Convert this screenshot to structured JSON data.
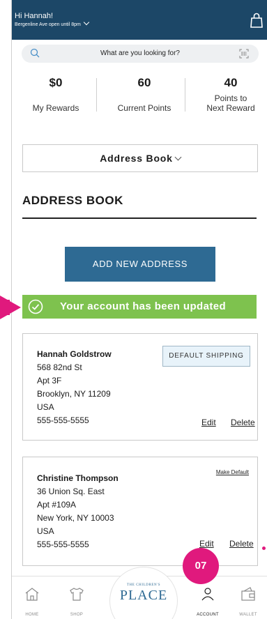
{
  "header": {
    "greeting": "Hi Hannah!",
    "store_status": "Bergenline Ave open until 8pm"
  },
  "search": {
    "placeholder": "What are you looking for?"
  },
  "stats": [
    {
      "value": "$0",
      "label": "My Rewards"
    },
    {
      "value": "60",
      "label": "Current Points"
    },
    {
      "value": "40",
      "label_line1": "Points to",
      "label_line2": "Next Reward"
    }
  ],
  "dropdown": {
    "label": "Address Book"
  },
  "section_title": "ADDRESS BOOK",
  "add_button": "ADD NEW ADDRESS",
  "banner": {
    "message": "Your account has been updated",
    "color": "#7ec24e"
  },
  "addresses": [
    {
      "name": "Hannah Goldstrow",
      "line1": "568 82nd St",
      "line2": "Apt 3F",
      "city": "Brooklyn, NY 11209",
      "country": "USA",
      "phone": "555-555-5555",
      "badge": "DEFAULT SHIPPING",
      "edit": "Edit",
      "delete": "Delete"
    },
    {
      "name": "Christine Thompson",
      "line1": "36 Union Sq. East",
      "line2": "Apt #109A",
      "city": "New York, NY 10003",
      "country": "USA",
      "phone": "555-555-5555",
      "make_default": "Make Default",
      "edit": "Edit",
      "delete": "Delete"
    }
  ],
  "tabbar": {
    "home": "HOME",
    "shop": "SHOP",
    "logo_small": "THE CHILDREN'S",
    "logo_big": "PLACE",
    "account": "ACCOUNT",
    "wallet": "WALLET"
  },
  "annotation": {
    "step": "07",
    "color": "#e0197d"
  },
  "colors": {
    "header": "#1c4767",
    "button": "#2e6a93"
  }
}
